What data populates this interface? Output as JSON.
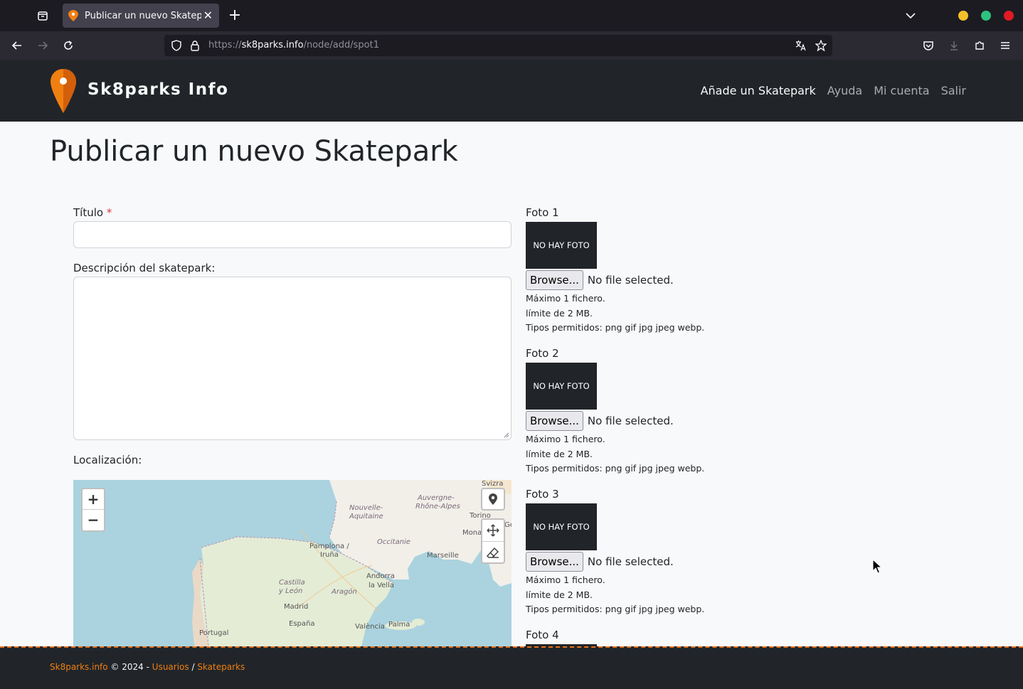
{
  "browser": {
    "tab_title": "Publicar un nuevo Skatepark",
    "url_prefix": "https://",
    "url_host": "sk8parks.info",
    "url_path": "/node/add/spot1"
  },
  "site": {
    "brand": "Sk8parks Info",
    "menu": [
      {
        "label": "Añade un Skatepark"
      },
      {
        "label": "Ayuda"
      },
      {
        "label": "Mi cuenta"
      },
      {
        "label": "Salir"
      }
    ]
  },
  "form": {
    "page_title": "Publicar un nuevo Skatepark",
    "title_label": "Título",
    "required_mark": "*",
    "title_value": "",
    "description_label": "Descripción del skatepark:",
    "description_value": "",
    "location_label": "Localización:"
  },
  "map": {
    "zoom_in": "+",
    "zoom_out": "−",
    "labels": [
      {
        "text": "Nouvelle-",
        "style": "it"
      },
      {
        "text": "Aquitaine",
        "style": "it"
      },
      {
        "text": "Auvergne-",
        "style": "it"
      },
      {
        "text": "Rhône-Alpes",
        "style": "it"
      },
      {
        "text": "Occitanie",
        "style": "it"
      },
      {
        "text": "Pamplona /",
        "style": ""
      },
      {
        "text": "Iruña",
        "style": ""
      },
      {
        "text": "Andorra",
        "style": ""
      },
      {
        "text": "la Vella",
        "style": ""
      },
      {
        "text": "Marseille",
        "style": ""
      },
      {
        "text": "Castilla",
        "style": "it"
      },
      {
        "text": "y León",
        "style": "it"
      },
      {
        "text": "Aragón",
        "style": "it"
      },
      {
        "text": "Madrid",
        "style": ""
      },
      {
        "text": "España",
        "style": ""
      },
      {
        "text": "València",
        "style": ""
      },
      {
        "text": "Palma",
        "style": ""
      },
      {
        "text": "Portugal",
        "style": ""
      },
      {
        "text": "Torino",
        "style": ""
      },
      {
        "text": "Mona",
        "style": ""
      },
      {
        "text": "Svizra",
        "style": ""
      },
      {
        "text": "Ge",
        "style": ""
      }
    ]
  },
  "fotos": [
    {
      "label": "Foto 1",
      "placeholder": "NO HAY FOTO",
      "browse": "Browse...",
      "status": "No file selected.",
      "help1": "Máximo 1 fichero.",
      "help2": "límite de 2 MB.",
      "help3": "Tipos permitidos: png gif jpg jpeg webp."
    },
    {
      "label": "Foto 2",
      "placeholder": "NO HAY FOTO",
      "browse": "Browse...",
      "status": "No file selected.",
      "help1": "Máximo 1 fichero.",
      "help2": "límite de 2 MB.",
      "help3": "Tipos permitidos: png gif jpg jpeg webp."
    },
    {
      "label": "Foto 3",
      "placeholder": "NO HAY FOTO",
      "browse": "Browse...",
      "status": "No file selected.",
      "help1": "Máximo 1 fichero.",
      "help2": "límite de 2 MB.",
      "help3": "Tipos permitidos: png gif jpg jpeg webp."
    },
    {
      "label": "Foto 4"
    }
  ],
  "footer": {
    "site_link": "Sk8parks.info",
    "copyright": " © 2024 - ",
    "users_link": "Usuarios",
    "sep": " / ",
    "parks_link": "Skateparks"
  },
  "colors": {
    "accent": "#f07f12",
    "header_bg": "#212529",
    "required": "#dc3545"
  }
}
